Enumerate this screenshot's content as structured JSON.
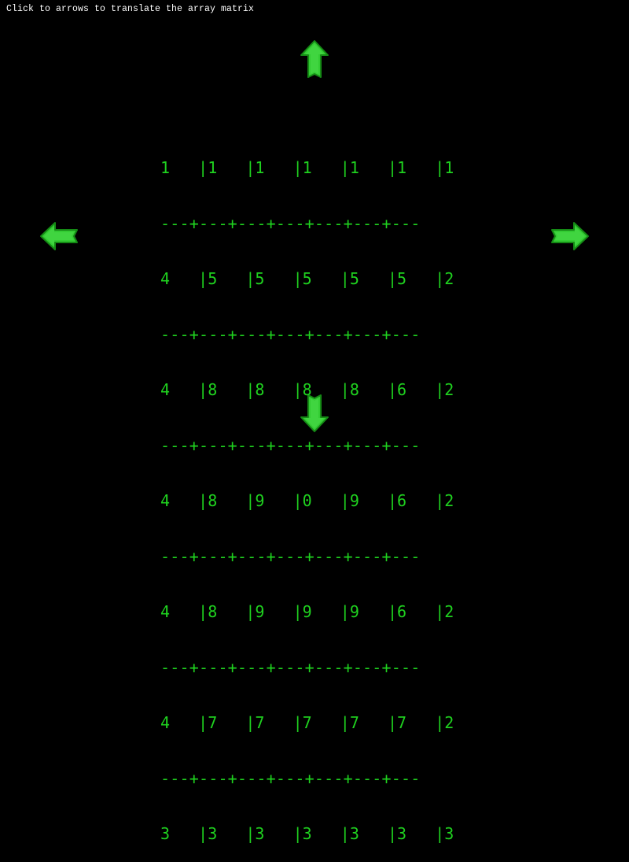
{
  "instruction": "Click to arrows to translate the array matrix",
  "colors": {
    "background": "#000000",
    "matrix_text": "#1fd21f",
    "arrow_fill": "#33cc33",
    "arrow_outline": "#158a15"
  },
  "arrows": {
    "up": "arrow-up-icon",
    "down": "arrow-down-icon",
    "left": "arrow-left-icon",
    "right": "arrow-right-icon"
  },
  "matrix": {
    "rows": [
      "1   |1   |1   |1   |1   |1   |1",
      "4   |5   |5   |5   |5   |5   |2",
      "4   |8   |8   |8   |8   |6   |2",
      "4   |8   |9   |0   |9   |6   |2",
      "4   |8   |9   |9   |9   |6   |2",
      "4   |7   |7   |7   |7   |7   |2",
      "3   |3   |3   |3   |3   |3   |3"
    ],
    "separator": "---+---+---+---+---+---+---"
  }
}
